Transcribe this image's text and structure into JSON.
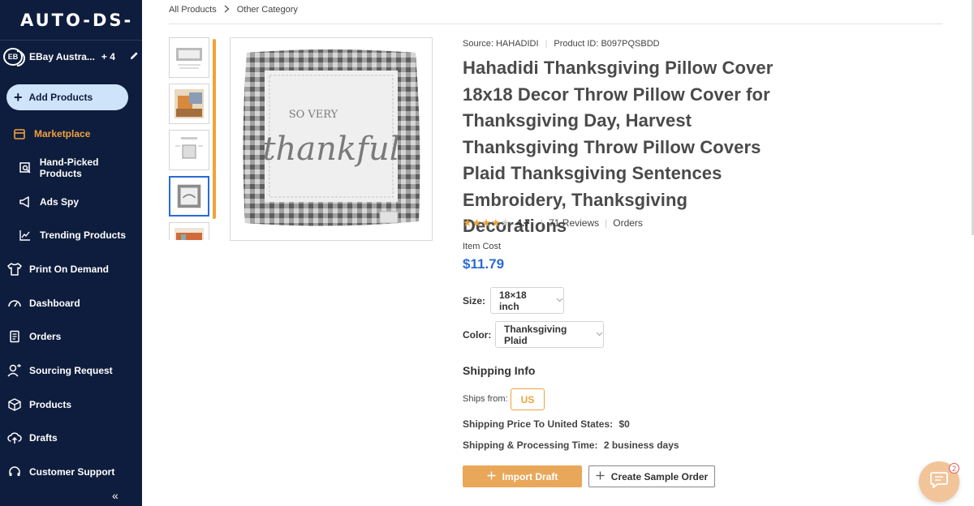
{
  "app": {
    "logo": "AUTO-DS-"
  },
  "sidebar": {
    "store_badge": "EB",
    "store_name": "EBay Austra...",
    "store_extra": "+ 4",
    "add_products": "Add Products",
    "items": [
      {
        "label": "Marketplace",
        "icon": "store-icon",
        "active": true
      },
      {
        "label": "Hand-Picked Products",
        "icon": "hand-picked-icon"
      },
      {
        "label": "Ads Spy",
        "icon": "megaphone-icon"
      },
      {
        "label": "Trending Products",
        "icon": "trend-chart-icon"
      },
      {
        "label": "Print On Demand",
        "icon": "shirt-icon"
      },
      {
        "label": "Dashboard",
        "icon": "gauge-icon"
      },
      {
        "label": "Orders",
        "icon": "clipboard-icon"
      },
      {
        "label": "Sourcing Request",
        "icon": "sourcing-icon"
      },
      {
        "label": "Products",
        "icon": "box-icon"
      },
      {
        "label": "Drafts",
        "icon": "cloud-upload-icon"
      },
      {
        "label": "Customer Support",
        "icon": "headset-icon"
      }
    ],
    "collapse": "«"
  },
  "breadcrumb": {
    "root": "All Products",
    "current": "Other Category"
  },
  "product": {
    "source": "Source: HAHADIDI",
    "product_id": "Product ID: B097PQSBDD",
    "title": "Hahadidi Thanksgiving Pillow Cover 18x18 Decor Throw Pillow Cover for Thanksgiving Day, Harvest Thanksgiving Throw Pillow Covers Plaid Thanksgiving Sentences Embroidery, Thanksgiving Decorations",
    "rating": "4.7",
    "reviews": "71 Reviews",
    "orders": "Orders",
    "cost_label": "Item Cost",
    "price": "$11.79",
    "size_label": "Size:",
    "size_value": "18×18 inch",
    "color_label": "Color:",
    "color_value": "Thanksgiving Plaid",
    "image_text_small": "SO VERY",
    "image_text_big": "thankful"
  },
  "shipping": {
    "heading": "Shipping Info",
    "ships_from_label": "Ships from:",
    "ships_from_value": "US",
    "price_label": "Shipping Price To United States:",
    "price_value": "$0",
    "time_label": "Shipping & Processing Time:",
    "time_value": "2 business days"
  },
  "actions": {
    "import": "Import Draft",
    "sample": "Create Sample Order"
  },
  "chat": {
    "badge": "2"
  },
  "colors": {
    "sidebar": "#0e1d3d",
    "accent": "#f0a23a",
    "price": "#2a6bd4"
  }
}
